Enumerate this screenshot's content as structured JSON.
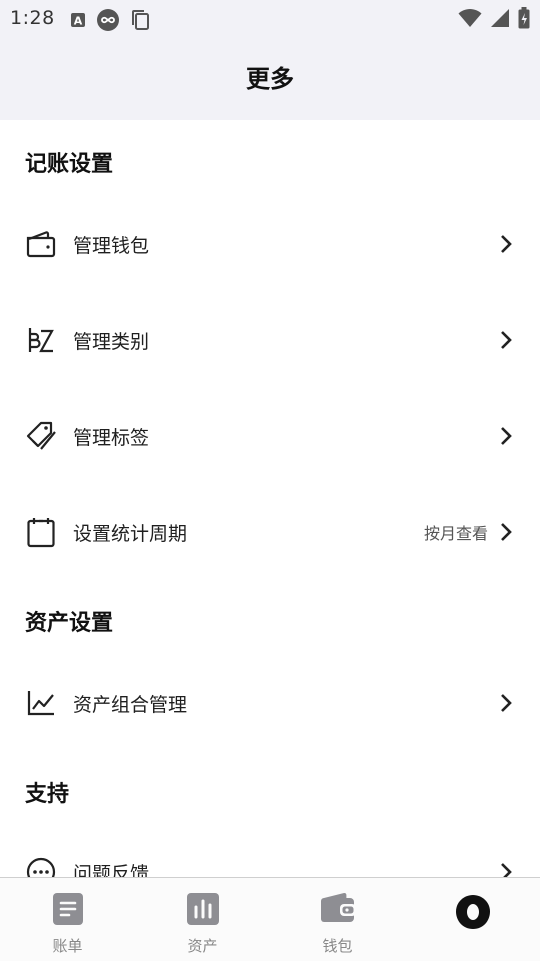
{
  "status": {
    "time": "1:28"
  },
  "header": {
    "title": "更多"
  },
  "sections": {
    "bookkeeping": {
      "title": "记账设置",
      "items": [
        {
          "label": "管理钱包",
          "icon": "wallet-icon"
        },
        {
          "label": "管理类别",
          "icon": "category-icon"
        },
        {
          "label": "管理标签",
          "icon": "tag-icon"
        },
        {
          "label": "设置统计周期",
          "value": "按月查看",
          "icon": "calendar-icon"
        }
      ]
    },
    "assets": {
      "title": "资产设置",
      "items": [
        {
          "label": "资产组合管理",
          "icon": "chart-line-icon"
        }
      ]
    },
    "support": {
      "title": "支持",
      "items": [
        {
          "label": "问题反馈",
          "icon": "feedback-icon"
        }
      ]
    }
  },
  "tabs": [
    {
      "label": "账单",
      "icon": "bill-icon"
    },
    {
      "label": "资产",
      "icon": "bar-chart-icon"
    },
    {
      "label": "钱包",
      "icon": "wallet-tab-icon"
    },
    {
      "label": "",
      "icon": "more-ring-icon",
      "active": true
    }
  ],
  "colors": {
    "header_bg": "#f2f2f7",
    "icon_dark": "#222222",
    "tab_icon": "#8e8e93"
  }
}
